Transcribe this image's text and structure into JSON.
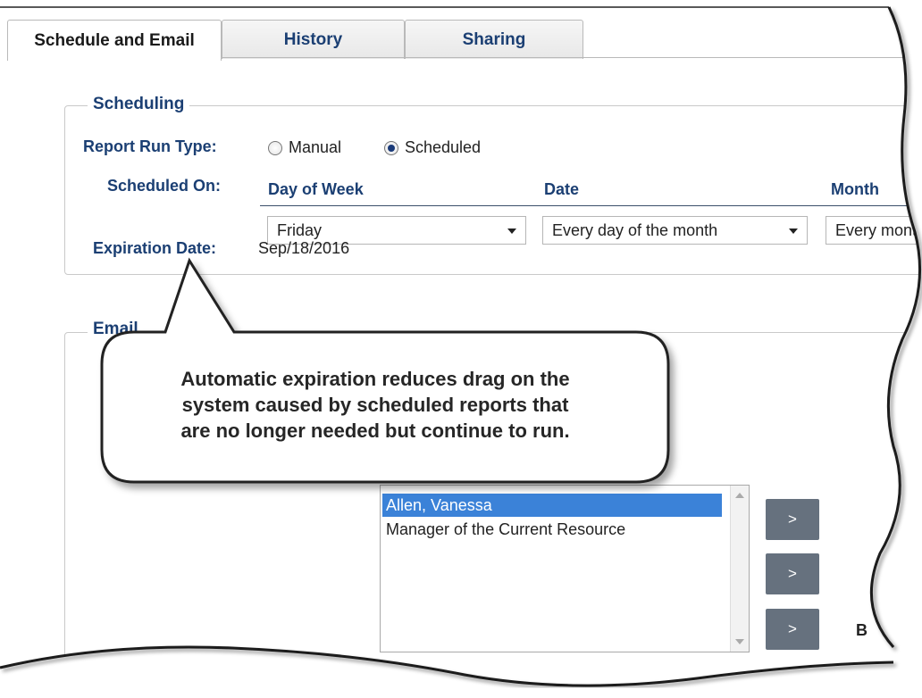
{
  "tabs": [
    {
      "label": "Schedule and Email"
    },
    {
      "label": "History"
    },
    {
      "label": "Sharing"
    }
  ],
  "scheduling": {
    "legend": "Scheduling",
    "run_type_label": "Report Run Type:",
    "run_type_options": [
      {
        "label": "Manual",
        "selected": false
      },
      {
        "label": "Scheduled",
        "selected": true
      }
    ],
    "scheduled_on_label": "Scheduled On:",
    "columns": [
      {
        "header": "Day of Week",
        "value": "Friday"
      },
      {
        "header": "Date",
        "value": "Every day of the month"
      },
      {
        "header": "Month",
        "value": "Every month"
      }
    ],
    "expiration_label": "Expiration Date:",
    "expiration_value": "Sep/18/2016"
  },
  "email": {
    "legend": "Email",
    "recipients": [
      {
        "label": "Allen, Vanessa",
        "selected": true
      },
      {
        "label": "Manager of the Current Resource",
        "selected": false
      }
    ],
    "move_buttons": [
      ">",
      ">",
      ">"
    ],
    "partial_text": "B"
  },
  "callout": {
    "lines": [
      "Automatic expiration reduces drag on the",
      "system caused by scheduled reports that",
      "are no longer needed but continue to run."
    ]
  },
  "colors": {
    "label_blue": "#1b3f73",
    "selection_blue": "#3b82d8",
    "button_gray": "#66717e"
  }
}
